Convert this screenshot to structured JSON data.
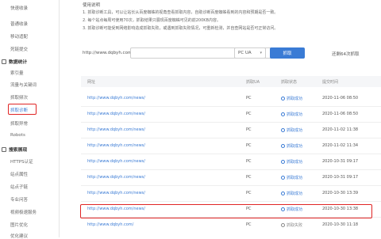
{
  "sidebar": {
    "items": [
      {
        "label": "快速收录",
        "type": "item"
      },
      {
        "label": "普通收录",
        "type": "item"
      },
      {
        "label": "移动适配",
        "type": "item"
      },
      {
        "label": "死链提交",
        "type": "item"
      },
      {
        "label": "数据统计",
        "type": "group"
      },
      {
        "label": "索引量",
        "type": "item"
      },
      {
        "label": "流量与关键词",
        "type": "item"
      },
      {
        "label": "抓取频次",
        "type": "item"
      },
      {
        "label": "抓取诊断",
        "type": "active"
      },
      {
        "label": "抓取异常",
        "type": "item"
      },
      {
        "label": "Robots",
        "type": "item"
      },
      {
        "label": "搜索展现",
        "type": "group"
      },
      {
        "label": "HTTPS认证",
        "type": "item"
      },
      {
        "label": "站点属性",
        "type": "item"
      },
      {
        "label": "站点子链",
        "type": "item"
      },
      {
        "label": "专业问答",
        "type": "item"
      },
      {
        "label": "视频极速服务",
        "type": "item"
      },
      {
        "label": "图片优化",
        "type": "item"
      },
      {
        "label": "优化建议",
        "type": "item"
      }
    ]
  },
  "instructions": {
    "title": "使用说明",
    "lines": [
      "1. 抓取诊断工具，可以让站长从百度蜘蛛的视角查看抓取内容，自助诊断百度蜘蛛看到的内容和预期是否一致。",
      "2. 每个站点每周可使用70次，抓取结果只展现百度蜘蛛可见的前200KB内容。",
      "3. 抓取诊断可能受到网络影响造成抓取失败，或遇到抓取失败情况，可重新检测，并自查网站是否可正常访问。"
    ]
  },
  "form": {
    "url_prefix": "http://www.dqbyh.com/",
    "url_value": "",
    "ua_selected": "PC UA",
    "fetch_label": "抓取",
    "remaining_text": "还剩64次抓取"
  },
  "table": {
    "headers": [
      "网址",
      "抓取UA",
      "抓取状态",
      "提交时间"
    ],
    "rows": [
      {
        "url": "http://www.dqbyh.com/news/",
        "ua": "PC",
        "status": "抓取成功",
        "status_type": "ok",
        "time": "2020-11-06 08:50"
      },
      {
        "url": "http://www.dqbyh.com/news/",
        "ua": "PC",
        "status": "抓取成功",
        "status_type": "ok",
        "time": "2020-11-06 08:50"
      },
      {
        "url": "http://www.dqbyh.com/news/",
        "ua": "PC",
        "status": "抓取成功",
        "status_type": "ok",
        "time": "2020-11-02 11:38"
      },
      {
        "url": "http://www.dqbyh.com/news/",
        "ua": "PC",
        "status": "抓取成功",
        "status_type": "ok",
        "time": "2020-11-02 11:34"
      },
      {
        "url": "http://www.dqbyh.com/news/",
        "ua": "PC",
        "status": "抓取成功",
        "status_type": "ok",
        "time": "2020-10-31 09:17"
      },
      {
        "url": "http://www.dqbyh.com/news/",
        "ua": "PC",
        "status": "抓取成功",
        "status_type": "ok",
        "time": "2020-10-31 09:17"
      },
      {
        "url": "http://www.dqbyh.com/news/",
        "ua": "PC",
        "status": "抓取成功",
        "status_type": "ok",
        "time": "2020-10-30 13:39"
      },
      {
        "url": "http://www.dqbyh.com/news/",
        "ua": "PC",
        "status": "抓取成功",
        "status_type": "ok",
        "time": "2020-10-30 13:38"
      },
      {
        "url": "http://www.dqbyh.com/",
        "ua": "PC",
        "status": "抓取失败",
        "status_type": "fail",
        "time": "2020-10-30 11:18"
      }
    ]
  },
  "colors": {
    "accent": "#3a7bd5",
    "highlight": "#e02424"
  }
}
